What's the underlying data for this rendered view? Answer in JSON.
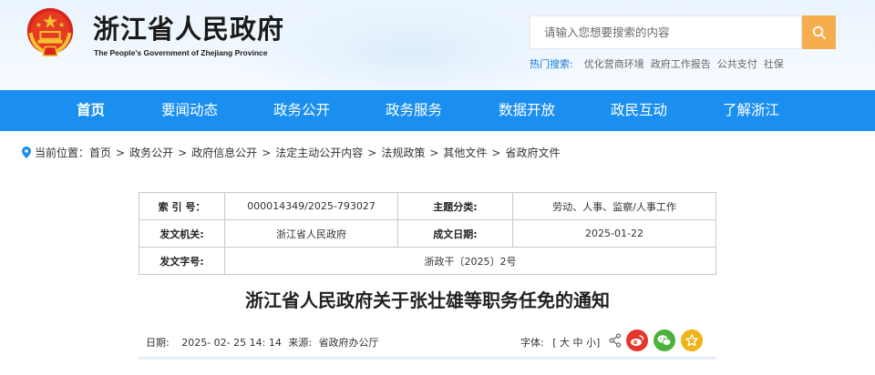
{
  "header": {
    "title": "浙江省人民政府",
    "subtitle": "The People's Government of Zhejiang Province",
    "search_placeholder": "请输入您想要搜索的内容",
    "hot_label": "热门搜索:",
    "hot_links": [
      "优化营商环境",
      "政府工作报告",
      "公共支付",
      "社保"
    ]
  },
  "nav": {
    "items": [
      "首页",
      "要闻动态",
      "政务公开",
      "政务服务",
      "数据开放",
      "政民互动",
      "了解浙江"
    ]
  },
  "breadcrumb": {
    "prefix": "当前位置：",
    "items": [
      "首页",
      "政务公开",
      "政府信息公开",
      "法定主动公开内容",
      "法规政策",
      "其他文件",
      "省政府文件"
    ],
    "sep": ">"
  },
  "info": {
    "index_label": "索 引 号：",
    "index_value": "000014349/2025-793027",
    "topic_label": "主题分类:",
    "topic_value": "劳动、人事、监察/人事工作",
    "issuer_label": "发文机关:",
    "issuer_value": "浙江省人民政府",
    "date_label": "成文日期:",
    "date_value": "2025-01-22",
    "docno_label": "发文字号:",
    "docno_value": "浙政干〔2025〕2号"
  },
  "article": {
    "title": "浙江省人民政府关于张壮雄等职务任免的通知",
    "date_label": "日期:",
    "date_value": "2025- 02- 25 14: 14",
    "source_label": "来源:",
    "source_value": "省政府办公厅",
    "font_label": "字体:",
    "font_options": "[ 大 中 小]"
  },
  "colors": {
    "nav_bg": "#1b8ff0",
    "search_button": "#f5ad4d",
    "hot_label": "#1a7ad5",
    "weibo": "#e6352b",
    "wechat": "#4ab23b",
    "favorite": "#f2b317"
  },
  "icons": [
    "national-emblem-icon",
    "search-icon",
    "location-pin-icon",
    "share-icon",
    "weibo-icon",
    "wechat-icon",
    "favorite-star-icon"
  ]
}
